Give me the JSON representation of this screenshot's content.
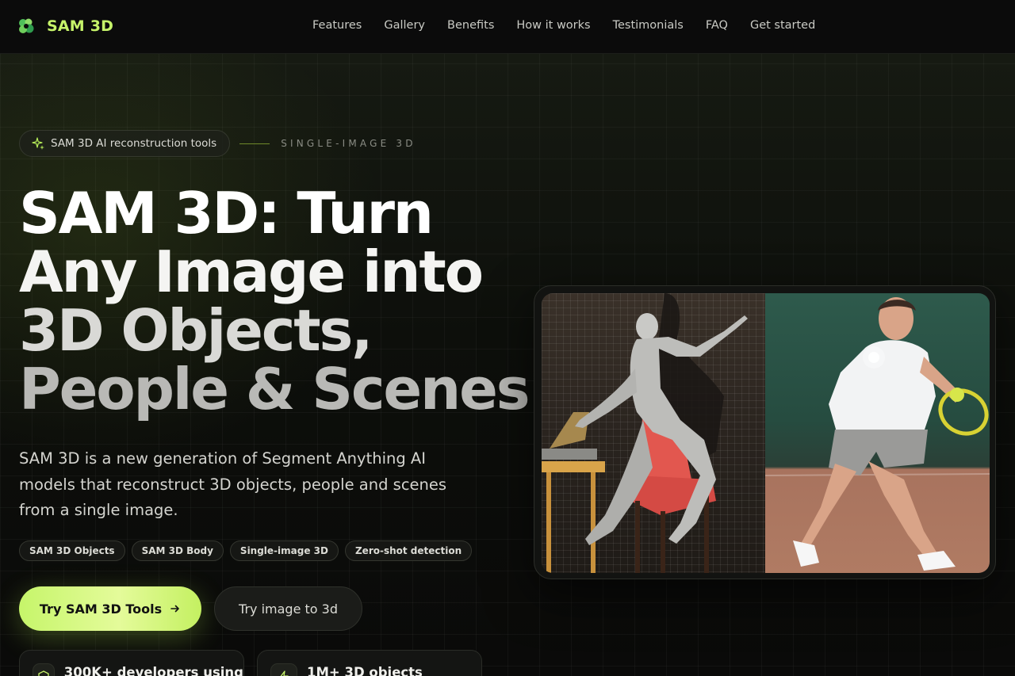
{
  "nav": {
    "brand": "SAM 3D",
    "links": [
      "Features",
      "Gallery",
      "Benefits",
      "How it works",
      "Testimonials",
      "FAQ",
      "Get started"
    ]
  },
  "hero": {
    "pill": "SAM 3D AI reconstruction tools",
    "eyebrow_tag": "SINGLE-IMAGE 3D",
    "headline": [
      "SAM 3D: Turn",
      "Any Image into",
      "3D Objects,",
      "People & Scenes"
    ],
    "description": "SAM 3D is a new generation of Segment Anything AI models that reconstruct 3D objects, people and scenes from a single image.",
    "tags": [
      "SAM 3D Objects",
      "SAM 3D Body",
      "Single-image 3D",
      "Zero-shot detection"
    ],
    "primary_cta": "Try SAM 3D Tools",
    "secondary_cta": "Try image to 3d",
    "stats": [
      "300K+ developers using",
      "1M+ 3D objects"
    ]
  },
  "colors": {
    "accent": "#c6f36a",
    "background": "#0a0b09"
  },
  "icons": {
    "logo": "sam3d-logo-icon",
    "pill": "sparkle-icon",
    "cta": "arrow-right-icon"
  }
}
